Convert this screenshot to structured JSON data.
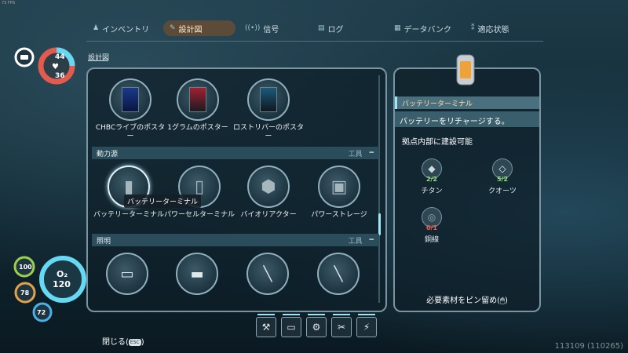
{
  "fps": "73 FPS",
  "nav": {
    "tabs": [
      {
        "label": "インベントリ",
        "icon": "person-icon"
      },
      {
        "label": "設計図",
        "icon": "blueprint-icon"
      },
      {
        "label": "信号",
        "icon": "signal-icon"
      },
      {
        "label": "ログ",
        "icon": "log-icon"
      },
      {
        "label": "データバンク",
        "icon": "databank-icon"
      },
      {
        "label": "適応状態",
        "icon": "dna-icon"
      }
    ],
    "active": "設計図"
  },
  "breadcrumb": "設計図",
  "stats": {
    "health": "44",
    "food": "36",
    "oxygen_label": "O₂",
    "oxygen": "120",
    "stat1": "100",
    "stat2": "78",
    "stat3": "72"
  },
  "posters": [
    {
      "label": "CHBCライブのポスター"
    },
    {
      "label": "1グラムのポスター"
    },
    {
      "label": "ロストリバーのポスター"
    }
  ],
  "categories": [
    {
      "name": "動力源",
      "tag": "工具",
      "toggle": "−"
    },
    {
      "name": "照明",
      "tag": "工具",
      "toggle": "−"
    }
  ],
  "power_items": [
    {
      "label": "バッテリーターミナル"
    },
    {
      "label": "パワーセルターミナル"
    },
    {
      "label": "バイオリアクター"
    },
    {
      "label": "パワーストレージ"
    }
  ],
  "tooltip": "バッテリーターミナル",
  "detail": {
    "title": "バッテリーターミナル",
    "description": "バッテリーをリチャージする。",
    "build_location": "拠点内部に建設可能",
    "materials": [
      {
        "name": "チタン",
        "count": "2/2",
        "color": "#8fe06a"
      },
      {
        "name": "クオーツ",
        "count": "5/2",
        "color": "#8fe06a"
      },
      {
        "name": "銅線",
        "count": "0/1",
        "color": "#ff5a4a"
      }
    ],
    "pin_hint": "必要素材をピン留め("
  },
  "close_label": "閉じる(",
  "esc_label": "ESC",
  "version": "113109 (110265)"
}
